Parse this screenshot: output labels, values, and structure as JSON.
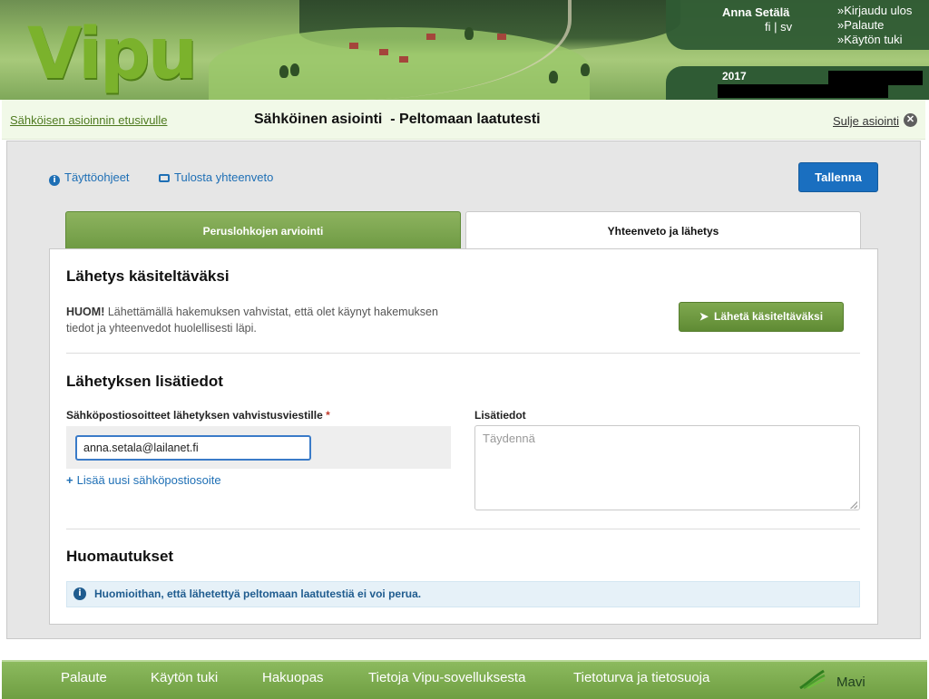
{
  "header": {
    "logo_text": "Vipu",
    "user_name": "Anna Setälä",
    "lang_fi": "fi",
    "lang_sep": "|",
    "lang_sv": "sv",
    "links": [
      "»Kirjaudu ulos",
      "»Palaute",
      "»Käytön tuki"
    ],
    "year": "2017"
  },
  "titlebar": {
    "home_link": "Sähköisen asioinnin etusivulle",
    "title": "Sähköinen asiointi  - Peltomaan laatutesti",
    "close_link": "Sulje asiointi",
    "close_icon": "✕"
  },
  "toolbar": {
    "help_link": "Täyttöohjeet",
    "print_link": "Tulosta yhteenveto",
    "save_label": "Tallenna"
  },
  "tabs": [
    {
      "label": "Peruslohkojen arviointi",
      "active": false
    },
    {
      "label": "Yhteenveto ja lähetys",
      "active": true
    }
  ],
  "send_section": {
    "heading": "Lähetys käsiteltäväksi",
    "note_bold": "HUOM!",
    "note_text": " Lähettämällä hakemuksen vahvistat, että olet käynyt hakemuksen tiedot ja yhteenvedot huolellisesti läpi.",
    "send_button": "Lähetä käsiteltäväksi"
  },
  "details_section": {
    "heading": "Lähetyksen lisätiedot",
    "email_label": "Sähköpostiosoitteet lähetyksen vahvistusviestille",
    "required_mark": "*",
    "email_value": "anna.setala@lailanet.fi",
    "add_email_link": "Lisää uusi sähköpostiosoite",
    "extra_label": "Lisätiedot",
    "extra_placeholder": "Täydennä"
  },
  "remarks_section": {
    "heading": "Huomautukset",
    "alert_text": "Huomioithan, että lähetettyä peltomaan laatutestiä ei voi perua."
  },
  "footer": {
    "links": [
      "Palaute",
      "Käytön tuki",
      "Hakuopas",
      "Tietoja Vipu-sovelluksesta",
      "Tietoturva ja tietosuoja"
    ],
    "brand": "Mavi"
  },
  "colors": {
    "primary_blue": "#1a6fc0",
    "green": "#6e9a43",
    "link_blue": "#1e6fb5"
  }
}
